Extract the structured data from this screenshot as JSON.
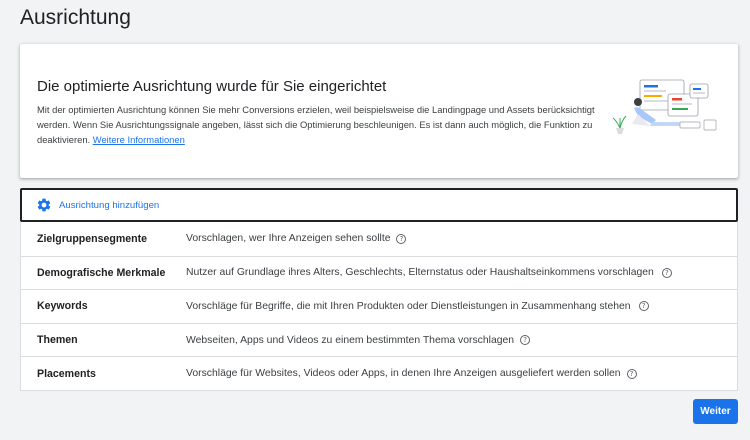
{
  "page": {
    "title": "Ausrichtung"
  },
  "info_card": {
    "heading": "Die optimierte Ausrichtung wurde für Sie eingerichtet",
    "body": "Mit der optimierten Ausrichtung können Sie mehr Conversions erzielen, weil beispielsweise die Landingpage und Assets berücksichtigt werden. Wenn Sie Ausrichtungssignale angeben, lässt sich die Optimierung beschleunigen. Es ist dann auch möglich, die Funktion zu deaktivieren. ",
    "link": "Weitere Informationen"
  },
  "add_targeting": {
    "label": "Ausrichtung hinzufügen",
    "icon": "gear-icon"
  },
  "rows": [
    {
      "label": "Zielgruppensegmente",
      "description": "Vorschlagen, wer Ihre Anzeigen sehen sollte"
    },
    {
      "label": "Demografische Merkmale",
      "description": "Nutzer auf Grundlage ihres Alters, Geschlechts, Elternstatus oder Haushaltseinkommens vorschlagen"
    },
    {
      "label": "Keywords",
      "description": "Vorschläge für Begriffe, die mit Ihren Produkten oder Dienstleistungen in Zusammenhang stehen"
    },
    {
      "label": "Themen",
      "description": "Webseiten, Apps und Videos zu einem bestimmten Thema vorschlagen"
    },
    {
      "label": "Placements",
      "description": "Vorschläge für Websites, Videos oder Apps, in denen Ihre Anzeigen ausgeliefert werden sollen"
    }
  ],
  "help_glyph": "?",
  "footer": {
    "next_label": "Weiter"
  },
  "colors": {
    "accent": "#1a73e8",
    "background": "#f1f3f4"
  }
}
